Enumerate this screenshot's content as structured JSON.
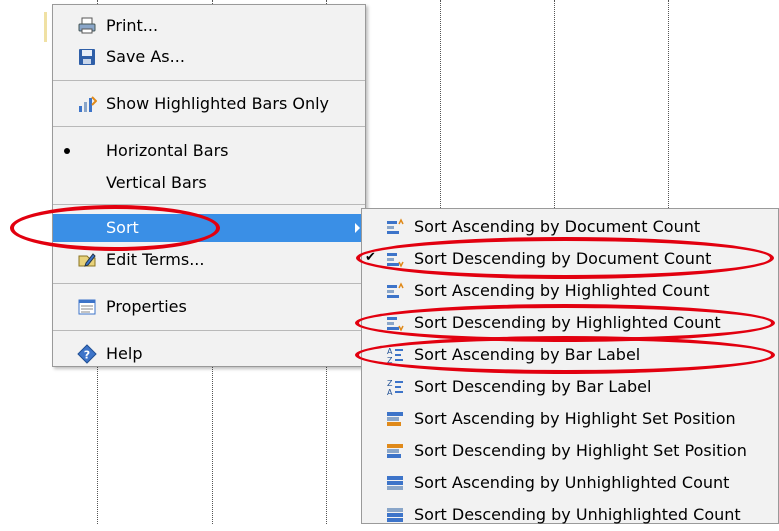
{
  "colors": {
    "menu_bg": "#f2f2f2",
    "highlight": "#3a8fe6",
    "annotation": "#e2000f",
    "icon_blue": "#3d74c9"
  },
  "menu": {
    "items": [
      {
        "label": "Print...",
        "icon": "printer-icon"
      },
      {
        "label": "Save As...",
        "icon": "floppy-disk-icon"
      },
      {
        "label": "Show Highlighted Bars Only",
        "icon": "highlighted-bars-icon"
      },
      {
        "label": "Horizontal Bars",
        "selected": true
      },
      {
        "label": "Vertical Bars"
      },
      {
        "label": "Sort",
        "highlighted": true,
        "has_submenu": true
      },
      {
        "label": "Edit Terms...",
        "icon": "edit-terms-icon"
      },
      {
        "label": "Properties",
        "icon": "properties-icon"
      },
      {
        "label": "Help",
        "icon": "help-icon"
      }
    ]
  },
  "submenu": {
    "items": [
      {
        "label": "Sort Ascending by Document Count",
        "icon": "sort-asc-count-icon"
      },
      {
        "label": "Sort Descending by Document Count",
        "icon": "sort-desc-count-icon",
        "checked": true
      },
      {
        "label": "Sort Ascending by Highlighted Count",
        "icon": "sort-asc-count-icon"
      },
      {
        "label": "Sort Descending by Highlighted Count",
        "icon": "sort-desc-count-icon"
      },
      {
        "label": "Sort Ascending by Bar Label",
        "icon": "sort-alpha-asc-icon"
      },
      {
        "label": "Sort Descending by Bar Label",
        "icon": "sort-alpha-desc-icon"
      },
      {
        "label": "Sort Ascending by Highlight Set Position",
        "icon": "sort-set-asc-icon"
      },
      {
        "label": "Sort Descending by Highlight Set Position",
        "icon": "sort-set-desc-icon"
      },
      {
        "label": "Sort Ascending by Unhighlighted Count",
        "icon": "sort-unhl-asc-icon"
      },
      {
        "label": "Sort Descending by Unhighlighted Count",
        "icon": "sort-unhl-desc-icon"
      }
    ]
  },
  "annotations": [
    "Sort",
    "Sort Descending by Document Count",
    "Sort Descending by Highlighted Count",
    "Sort Ascending by Bar Label"
  ]
}
